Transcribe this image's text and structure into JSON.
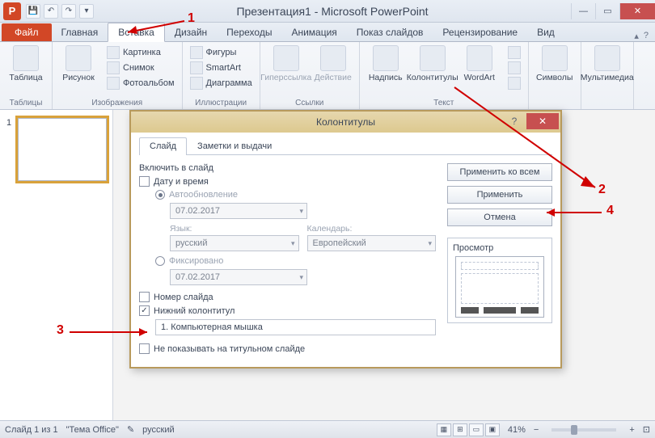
{
  "titlebar": {
    "app_letter": "P",
    "title": "Презентация1 - Microsoft PowerPoint"
  },
  "tabs": {
    "file": "Файл",
    "items": [
      "Главная",
      "Вставка",
      "Дизайн",
      "Переходы",
      "Анимация",
      "Показ слайдов",
      "Рецензирование",
      "Вид"
    ],
    "active_index": 1
  },
  "ribbon": {
    "tables": {
      "big": "Таблица",
      "label": "Таблицы"
    },
    "images": {
      "big": "Рисунок",
      "items": [
        "Картинка",
        "Снимок",
        "Фотоальбом"
      ],
      "label": "Изображения"
    },
    "illustrations": {
      "items": [
        "Фигуры",
        "SmartArt",
        "Диаграмма"
      ],
      "label": "Иллюстрации"
    },
    "links": {
      "big1": "Гиперссылка",
      "big2": "Действие",
      "label": "Ссылки"
    },
    "text": {
      "big1": "Надпись",
      "big2": "Колонтитулы",
      "big3": "WordArt",
      "label": "Текст"
    },
    "symbols": {
      "big": "Символы"
    },
    "media": {
      "big": "Мультимедиа"
    }
  },
  "slidepanel": {
    "num": "1"
  },
  "dialog": {
    "title": "Колонтитулы",
    "tabs": [
      "Слайд",
      "Заметки и выдачи"
    ],
    "include_label": "Включить в слайд",
    "date_time": "Дату и время",
    "auto_update": "Автообновление",
    "date_value": "07.02.2017",
    "lang_label": "Язык:",
    "lang_value": "русский",
    "cal_label": "Календарь:",
    "cal_value": "Европейский",
    "fixed": "Фиксировано",
    "fixed_value": "07.02.2017",
    "slide_number": "Номер слайда",
    "footer": "Нижний колонтитул",
    "footer_text": "1. Компьютерная мышка",
    "hide_title": "Не показывать на титульном слайде",
    "apply_all": "Применить ко всем",
    "apply": "Применить",
    "cancel": "Отмена",
    "preview": "Просмотр"
  },
  "annotations": {
    "n1": "1",
    "n2": "2",
    "n3": "3",
    "n4": "4"
  },
  "statusbar": {
    "slide": "Слайд 1 из 1",
    "theme": "\"Тема Office\"",
    "lang": "русский",
    "zoom": "41%"
  }
}
